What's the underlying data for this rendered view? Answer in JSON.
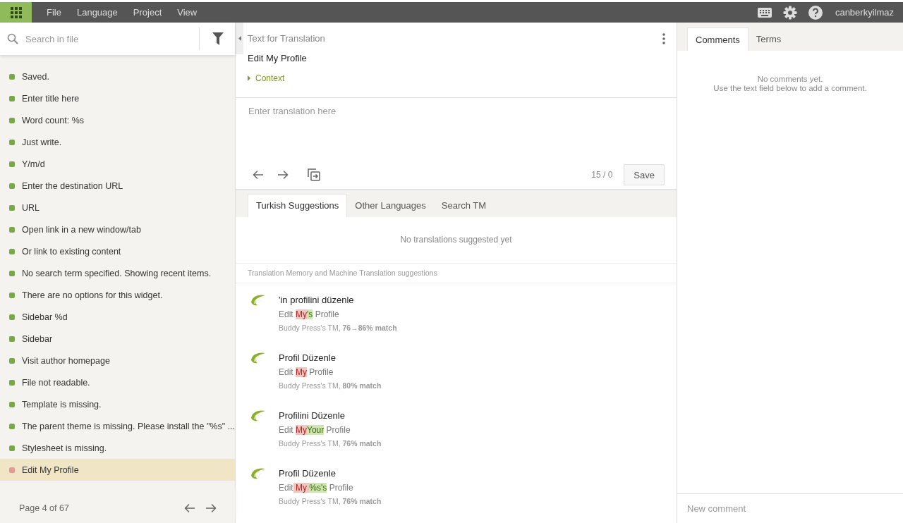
{
  "menu_bar": {
    "menus": [
      "File",
      "Language",
      "Project",
      "View"
    ],
    "user": "canberkyilmaz"
  },
  "sidebar": {
    "search": {
      "placeholder": "Search in file"
    },
    "items": [
      {
        "text": "Saved.",
        "color": "#78a847",
        "selected": false
      },
      {
        "text": "Enter title here",
        "color": "#78a847",
        "selected": false
      },
      {
        "text": "Word count: %s",
        "color": "#78a847",
        "selected": false
      },
      {
        "text": "Just write.",
        "color": "#78a847",
        "selected": false
      },
      {
        "text": "Y/m/d",
        "color": "#78a847",
        "selected": false
      },
      {
        "text": "Enter the destination URL",
        "color": "#78a847",
        "selected": false
      },
      {
        "text": "URL",
        "color": "#78a847",
        "selected": false
      },
      {
        "text": "Open link in a new window/tab",
        "color": "#78a847",
        "selected": false
      },
      {
        "text": "Or link to existing content",
        "color": "#78a847",
        "selected": false
      },
      {
        "text": "No search term specified. Showing recent items.",
        "color": "#78a847",
        "selected": false
      },
      {
        "text": "There are no options for this widget.",
        "color": "#78a847",
        "selected": false
      },
      {
        "text": "Sidebar %d",
        "color": "#78a847",
        "selected": false
      },
      {
        "text": "Sidebar",
        "color": "#78a847",
        "selected": false
      },
      {
        "text": "Visit author homepage",
        "color": "#78a847",
        "selected": false
      },
      {
        "text": "File not readable.",
        "color": "#78a847",
        "selected": false
      },
      {
        "text": "Template is missing.",
        "color": "#78a847",
        "selected": false
      },
      {
        "text": "The parent theme is missing. Please install the \"%s\" ...",
        "color": "#78a847",
        "selected": false
      },
      {
        "text": "Stylesheet is missing.",
        "color": "#78a847",
        "selected": false
      },
      {
        "text": "Edit My Profile",
        "color": "#e59a9a",
        "selected": true
      }
    ],
    "pager": "Page 4 of 67"
  },
  "editor": {
    "header": "Text for Translation",
    "source": "Edit My Profile",
    "context": "Context",
    "translation": {
      "placeholder": "Enter translation here"
    },
    "counter": "15 / 0",
    "save": "Save",
    "tabs": [
      {
        "label": "Turkish Suggestions",
        "selected": true
      },
      {
        "label": "Other Languages",
        "selected": false
      },
      {
        "label": "Search TM",
        "selected": false
      }
    ],
    "empty_message": "No translations suggested yet",
    "section_title": "Translation Memory and Machine Translation suggestions",
    "suggestions": [
      {
        "translation": "'in profilini düzenle",
        "source": [
          {
            "kind": "same",
            "text": "Edit "
          },
          {
            "kind": "removed",
            "text": "My"
          },
          {
            "kind": "added",
            "text": "'s"
          },
          {
            "kind": "same",
            "text": " Profile"
          }
        ],
        "meta": "Buddy Press's TM, ",
        "match": "76→86% match"
      },
      {
        "translation": "Profil Düzenle",
        "source": [
          {
            "kind": "same",
            "text": "Edit "
          },
          {
            "kind": "removed",
            "text": "My"
          },
          {
            "kind": "same",
            "text": " Profile"
          }
        ],
        "meta": "Buddy Press's TM, ",
        "match": "80% match"
      },
      {
        "translation": "Profilini Düzenle",
        "source": [
          {
            "kind": "same",
            "text": "Edit "
          },
          {
            "kind": "removed",
            "text": "My"
          },
          {
            "kind": "added",
            "text": "Your"
          },
          {
            "kind": "same",
            "text": " Profile"
          }
        ],
        "meta": "Buddy Press's TM, ",
        "match": "76% match"
      },
      {
        "translation": "Profil Düzenle",
        "source": [
          {
            "kind": "same",
            "text": "Edit"
          },
          {
            "kind": "removed",
            "text": " My "
          },
          {
            "kind": "added",
            "text": "%s's"
          },
          {
            "kind": "same",
            "text": " Profile"
          }
        ],
        "meta": "Buddy Press's TM, ",
        "match": "76% match"
      }
    ]
  },
  "comments": {
    "tabs": [
      {
        "label": "Comments",
        "selected": true
      },
      {
        "label": "Terms",
        "selected": false
      }
    ],
    "empty_title": "No comments yet.",
    "empty_hint": "Use the text field below to add a comment.",
    "new_comment": {
      "placeholder": "New comment"
    }
  }
}
